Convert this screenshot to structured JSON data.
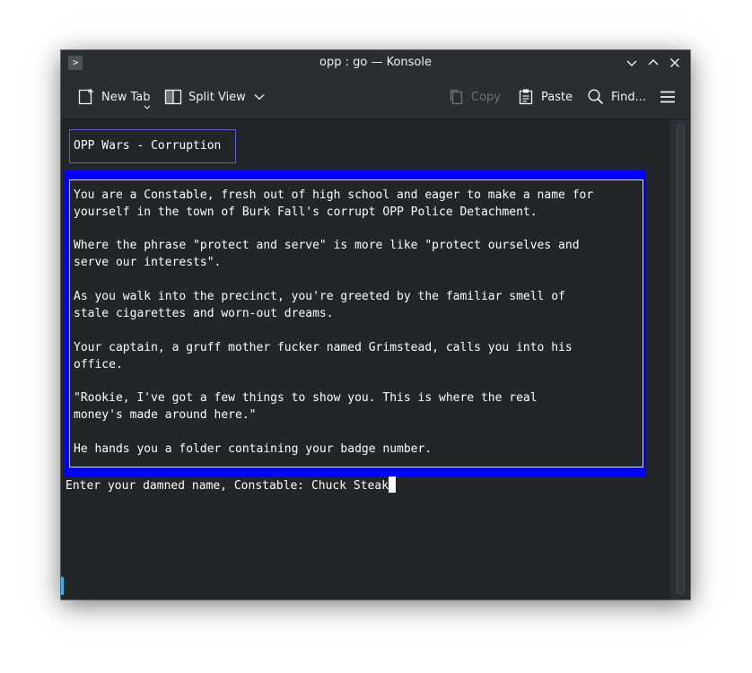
{
  "window": {
    "title": "opp : go — Konsole"
  },
  "toolbar": {
    "new_tab": "New Tab",
    "split_view": "Split View",
    "copy": "Copy",
    "paste": "Paste",
    "find": "Find..."
  },
  "terminal": {
    "game_title": "OPP Wars - Corruption",
    "story_lines": [
      "You are a Constable, fresh out of high school and eager to make a name for",
      "yourself in the town of Burk Fall's corrupt OPP Police Detachment.",
      "",
      "Where the phrase \"protect and serve\" is more like \"protect ourselves and",
      "serve our interests\".",
      "",
      "As you walk into the precinct, you're greeted by the familiar smell of",
      "stale cigarettes and worn-out dreams.",
      "",
      "Your captain, a gruff mother fucker named Grimstead, calls you into his",
      "office.",
      "",
      "\"Rookie, I've got a few things to show you. This is where the real",
      "money's made around here.\"",
      "",
      "He hands you a folder containing your badge number."
    ],
    "prompt": "Enter your damned name, Constable: ",
    "input_value": "Chuck Steak"
  },
  "colors": {
    "terminal_bg": "#232629",
    "story_frame": "#0000ff",
    "title_frame": "#5b5fc7",
    "text": "#fcfcfc"
  }
}
